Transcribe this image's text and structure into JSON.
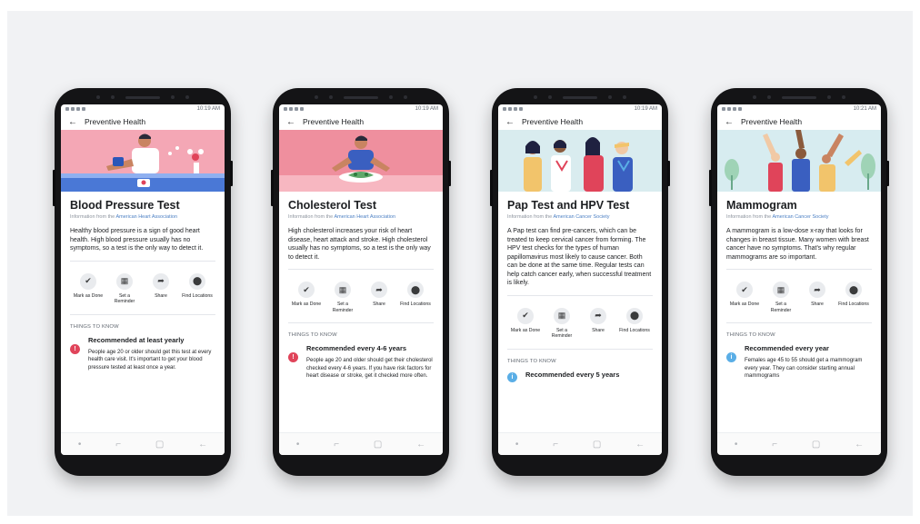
{
  "colors": {
    "background": "#f1f2f4",
    "phone_body": "#141416",
    "link": "#4d80c4",
    "bp_hero": "#f4a7b5",
    "chol_hero": "#ef8f9e",
    "pap_hero": "#d9ecef",
    "mammo_hero": "#d7ecf0",
    "red_badge": "#e0445a",
    "blue_badge": "#5aaee6"
  },
  "phones": [
    {
      "status_time": "10:19 AM",
      "nav_title": "Preventive Health",
      "title": "Blood Pressure Test",
      "source_prefix": "Information from the ",
      "source_name": "American Heart Association",
      "description": "Healthy blood pressure is a sign of good heart health. High blood pressure usually has no symptoms, so a test is the only way to detect it.",
      "actions": [
        {
          "label": "Mark as Done",
          "icon": "check-icon"
        },
        {
          "label": "Set a Reminder",
          "icon": "calendar-icon"
        },
        {
          "label": "Share",
          "icon": "share-icon"
        },
        {
          "label": "Find Locations",
          "icon": "location-pin-icon"
        }
      ],
      "things_heading": "THINGS TO KNOW",
      "recommendation_title": "Recommended at least yearly",
      "recommendation_body": "People age 20 or older should get this test at every health care visit. It's important to get your blood pressure tested at least once a year.",
      "recommendation_icon": "alert-icon"
    },
    {
      "status_time": "10:19 AM",
      "nav_title": "Preventive Health",
      "title": "Cholesterol Test",
      "source_prefix": "Information from the ",
      "source_name": "American Heart Association",
      "description": "High cholesterol increases your risk of heart disease, heart attack and stroke. High cholesterol usually has no symptoms, so a test is the only way to detect it.",
      "actions": [
        {
          "label": "Mark as Done",
          "icon": "check-icon"
        },
        {
          "label": "Set a Reminder",
          "icon": "calendar-icon"
        },
        {
          "label": "Share",
          "icon": "share-icon"
        },
        {
          "label": "Find Locations",
          "icon": "location-pin-icon"
        }
      ],
      "things_heading": "THINGS TO KNOW",
      "recommendation_title": "Recommended every 4-6 years",
      "recommendation_body": "People age 20 and older should get their cholesterol checked every 4-6 years. If you have risk factors for heart disease or stroke, get it checked more often.",
      "recommendation_icon": "alert-icon"
    },
    {
      "status_time": "10:19 AM",
      "nav_title": "Preventive Health",
      "title": "Pap Test and HPV Test",
      "source_prefix": "Information from the ",
      "source_name": "American Cancer Society",
      "description": "A Pap test can find pre-cancers, which can be treated to keep cervical cancer from forming. The HPV test checks for the types of human papillomavirus most likely to cause cancer. Both can be done at the same time. Regular tests can help catch cancer early, when successful treatment is likely.",
      "actions": [
        {
          "label": "Mark as Done",
          "icon": "check-icon"
        },
        {
          "label": "Set a Reminder",
          "icon": "calendar-icon"
        },
        {
          "label": "Share",
          "icon": "share-icon"
        },
        {
          "label": "Find Locations",
          "icon": "location-pin-icon"
        }
      ],
      "things_heading": "THINGS TO KNOW",
      "recommendation_title": "Recommended every 5 years",
      "recommendation_body": "",
      "recommendation_icon": "info-icon"
    },
    {
      "status_time": "10:21 AM",
      "nav_title": "Preventive Health",
      "title": "Mammogram",
      "source_prefix": "Information from the ",
      "source_name": "American Cancer Society",
      "description": "A mammogram is a low-dose x-ray that looks for changes in breast tissue. Many women with breast cancer have no symptoms. That's why regular mammograms are so important.",
      "actions": [
        {
          "label": "Mark as Done",
          "icon": "check-icon"
        },
        {
          "label": "Set a Reminder",
          "icon": "calendar-icon"
        },
        {
          "label": "Share",
          "icon": "share-icon"
        },
        {
          "label": "Find Locations",
          "icon": "location-pin-icon"
        }
      ],
      "things_heading": "THINGS TO KNOW",
      "recommendation_title": "Recommended every year",
      "recommendation_body": "Females age 45 to 55 should get a mammogram every year. They can consider starting annual mammograms",
      "recommendation_icon": "info-icon"
    }
  ]
}
